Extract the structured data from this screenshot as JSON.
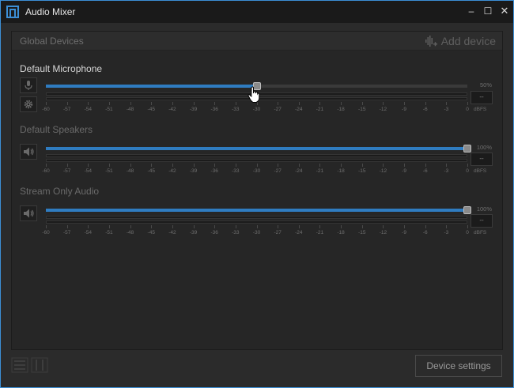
{
  "window": {
    "title": "Audio Mixer",
    "minimize": "–",
    "maximize": "☐",
    "close": "✕"
  },
  "panel": {
    "title": "Global Devices",
    "add_device_label": "Add device"
  },
  "ticks": [
    "-60",
    "-57",
    "-54",
    "-51",
    "-48",
    "-45",
    "-42",
    "-39",
    "-36",
    "-33",
    "-30",
    "-27",
    "-24",
    "-21",
    "-18",
    "-15",
    "-12",
    "-9",
    "-6",
    "-3",
    "0"
  ],
  "devices": [
    {
      "name": "Default Microphone",
      "volume": 50,
      "percent_label": "50%",
      "level_label": "--",
      "unit_label": "dBFS"
    },
    {
      "name": "Default Speakers",
      "volume": 100,
      "percent_label": "100%",
      "level_label": "--",
      "unit_label": "dBFS"
    },
    {
      "name": "Stream Only Audio",
      "volume": 100,
      "percent_label": "100%",
      "level_label": "--",
      "unit_label": "dBFS"
    }
  ],
  "footer": {
    "device_settings_label": "Device settings"
  },
  "colors": {
    "accent": "#2f7cc0",
    "window_border": "#3c8fd6",
    "active_text": "#d6d6d6",
    "inactive_text": "#6a6a6a"
  }
}
